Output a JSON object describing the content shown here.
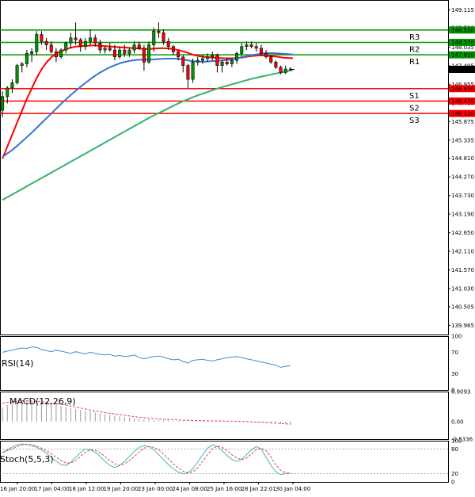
{
  "colors": {
    "resistance": "#009900",
    "support": "#ff0000",
    "bull_candle": "#009900",
    "bear_candle": "#ff0000",
    "ma_fast": "#ff0000",
    "ma_mid": "#3b6fd6",
    "ma_slow": "#33b36b",
    "rsi": "#3b8fd6",
    "macd_hist": "#999999",
    "macd_signal": "#e04040",
    "stoch_k": "#3fb6c8",
    "stoch_d": "#e04040",
    "last_price_bg": "#000000",
    "resistance_tag_bg": "#009900",
    "support_tag_bg": "#ff0000"
  },
  "chart_data": [
    {
      "type": "candlestick",
      "title": "",
      "ylim": [
        139.7,
        149.4
      ],
      "y_ticks": [
        "149.115",
        "148.590",
        "148.035",
        "147.495",
        "146.955",
        "146.415",
        "145.875",
        "145.335",
        "144.810",
        "144.270",
        "143.730",
        "143.190",
        "142.650",
        "142.110",
        "141.570",
        "141.030",
        "140.505",
        "139.965"
      ],
      "x_ticks": [
        "16 Jan 20:00",
        "17 Jan 04:00",
        "18 Jan 12:00",
        "19 Jan 20:00",
        "23 Jan 00:00",
        "24 Jan 08:00",
        "25 Jan 16:00",
        "28 Jan 22:01",
        "30 Jan 04:00"
      ],
      "last_price": {
        "label": "147.389",
        "value": 147.389
      },
      "levels": [
        {
          "name": "R3",
          "tag": "148.530",
          "value": 148.53,
          "kind": "resistance"
        },
        {
          "name": "R2",
          "tag": "148.170",
          "value": 148.17,
          "kind": "resistance"
        },
        {
          "name": "R1",
          "tag": "147.810",
          "value": 147.81,
          "kind": "resistance"
        },
        {
          "name": "S1",
          "tag": "146.830",
          "value": 146.83,
          "kind": "support"
        },
        {
          "name": "S2",
          "tag": "146.470",
          "value": 146.47,
          "kind": "support"
        },
        {
          "name": "S3",
          "tag": "146.110",
          "value": 146.11,
          "kind": "support"
        }
      ],
      "ohlc": [
        [
          146.2,
          146.75,
          146.0,
          146.6
        ],
        [
          146.6,
          146.9,
          146.4,
          146.85
        ],
        [
          146.85,
          147.1,
          146.7,
          147.0
        ],
        [
          147.0,
          147.55,
          146.95,
          147.5
        ],
        [
          147.5,
          147.6,
          147.3,
          147.55
        ],
        [
          147.55,
          147.95,
          147.45,
          147.85
        ],
        [
          147.85,
          148.0,
          147.6,
          147.9
        ],
        [
          147.9,
          148.5,
          147.8,
          148.4
        ],
        [
          148.4,
          148.5,
          148.1,
          148.2
        ],
        [
          148.2,
          148.3,
          147.95,
          148.1
        ],
        [
          148.1,
          148.2,
          147.85,
          147.9
        ],
        [
          147.9,
          148.0,
          147.6,
          147.75
        ],
        [
          147.75,
          148.0,
          147.7,
          147.95
        ],
        [
          147.95,
          148.2,
          147.85,
          148.15
        ],
        [
          148.15,
          148.45,
          148.0,
          148.3
        ],
        [
          148.3,
          148.75,
          148.1,
          148.25
        ],
        [
          148.25,
          148.3,
          147.9,
          148.05
        ],
        [
          148.05,
          148.3,
          147.95,
          148.2
        ],
        [
          148.2,
          148.55,
          148.1,
          148.3
        ],
        [
          148.3,
          148.4,
          148.05,
          148.15
        ],
        [
          148.15,
          148.25,
          147.85,
          147.95
        ],
        [
          147.95,
          148.05,
          147.85,
          148.0
        ],
        [
          148.0,
          148.15,
          147.9,
          147.95
        ],
        [
          147.95,
          148.1,
          147.65,
          147.75
        ],
        [
          147.75,
          148.05,
          147.7,
          147.95
        ],
        [
          147.95,
          148.1,
          147.75,
          147.85
        ],
        [
          147.85,
          148.0,
          147.75,
          147.95
        ],
        [
          147.95,
          148.2,
          147.85,
          148.1
        ],
        [
          148.1,
          148.2,
          147.95,
          148.0
        ],
        [
          148.0,
          148.1,
          147.35,
          147.6
        ],
        [
          147.6,
          148.2,
          147.55,
          148.1
        ],
        [
          148.1,
          148.6,
          147.9,
          148.5
        ],
        [
          148.5,
          148.75,
          148.3,
          148.45
        ],
        [
          148.45,
          148.55,
          148.1,
          148.2
        ],
        [
          148.2,
          148.3,
          147.95,
          148.05
        ],
        [
          148.05,
          148.1,
          147.8,
          147.9
        ],
        [
          147.9,
          147.95,
          147.65,
          147.75
        ],
        [
          147.75,
          147.8,
          147.3,
          147.5
        ],
        [
          147.5,
          147.55,
          146.85,
          147.1
        ],
        [
          147.1,
          147.7,
          147.0,
          147.6
        ],
        [
          147.6,
          147.75,
          147.5,
          147.65
        ],
        [
          147.65,
          147.8,
          147.55,
          147.7
        ],
        [
          147.7,
          147.85,
          147.6,
          147.75
        ],
        [
          147.75,
          147.9,
          147.65,
          147.8
        ],
        [
          147.8,
          147.85,
          147.3,
          147.5
        ],
        [
          147.5,
          147.65,
          147.3,
          147.6
        ],
        [
          147.6,
          147.7,
          147.5,
          147.55
        ],
        [
          147.55,
          147.7,
          147.45,
          147.65
        ],
        [
          147.65,
          147.9,
          147.55,
          147.85
        ],
        [
          147.85,
          148.15,
          147.75,
          148.05
        ],
        [
          148.05,
          148.2,
          147.95,
          148.1
        ],
        [
          148.1,
          148.2,
          148.0,
          148.05
        ],
        [
          148.05,
          148.15,
          147.9,
          148.0
        ],
        [
          148.0,
          148.1,
          147.8,
          147.85
        ],
        [
          147.85,
          147.95,
          147.7,
          147.75
        ],
        [
          147.75,
          147.8,
          147.55,
          147.6
        ],
        [
          147.6,
          147.65,
          147.4,
          147.45
        ],
        [
          147.45,
          147.5,
          147.25,
          147.3
        ],
        [
          147.3,
          147.5,
          147.25,
          147.4
        ],
        [
          147.4,
          147.45,
          147.35,
          147.39
        ]
      ],
      "moving_averages": [
        {
          "color_key": "ma_fast",
          "values": [
            144.8,
            145.15,
            145.5,
            145.85,
            146.2,
            146.55,
            146.85,
            147.15,
            147.4,
            147.6,
            147.75,
            147.85,
            147.92,
            147.98,
            148.02,
            148.05,
            148.06,
            148.07,
            148.08,
            148.08,
            148.07,
            148.06,
            148.05,
            148.04,
            148.03,
            148.02,
            148.01,
            148.0,
            147.99,
            147.98,
            147.98,
            147.99,
            148.0,
            148.0,
            147.99,
            147.97,
            147.94,
            147.9,
            147.85,
            147.8,
            147.77,
            147.75,
            147.74,
            147.73,
            147.72,
            147.71,
            147.71,
            147.71,
            147.72,
            147.74,
            147.76,
            147.78,
            147.79,
            147.79,
            147.78,
            147.77,
            147.75,
            147.73,
            147.72,
            147.71
          ]
        },
        {
          "color_key": "ma_mid",
          "values": [
            144.85,
            144.95,
            145.05,
            145.17,
            145.3,
            145.43,
            145.56,
            145.7,
            145.84,
            145.98,
            146.12,
            146.26,
            146.4,
            146.53,
            146.66,
            146.78,
            146.9,
            147.01,
            147.12,
            147.22,
            147.31,
            147.39,
            147.46,
            147.52,
            147.57,
            147.61,
            147.64,
            147.66,
            147.67,
            147.67,
            147.67,
            147.68,
            147.69,
            147.7,
            147.7,
            147.7,
            147.69,
            147.67,
            147.64,
            147.62,
            147.61,
            147.61,
            147.62,
            147.63,
            147.64,
            147.65,
            147.67,
            147.69,
            147.72,
            147.75,
            147.78,
            147.81,
            147.83,
            147.85,
            147.86,
            147.86,
            147.85,
            147.84,
            147.83,
            147.82
          ]
        },
        {
          "color_key": "ma_slow",
          "values": [
            143.6,
            143.68,
            143.76,
            143.84,
            143.92,
            144.0,
            144.08,
            144.16,
            144.24,
            144.32,
            144.4,
            144.48,
            144.56,
            144.64,
            144.72,
            144.8,
            144.88,
            144.96,
            145.04,
            145.12,
            145.2,
            145.28,
            145.36,
            145.44,
            145.52,
            145.6,
            145.68,
            145.76,
            145.84,
            145.92,
            146.0,
            146.07,
            146.14,
            146.21,
            146.28,
            146.35,
            146.42,
            146.48,
            146.54,
            146.6,
            146.65,
            146.7,
            146.75,
            146.8,
            146.85,
            146.89,
            146.93,
            146.97,
            147.01,
            147.05,
            147.09,
            147.13,
            147.16,
            147.19,
            147.22,
            147.25,
            147.28,
            147.31,
            147.34,
            147.37
          ]
        }
      ]
    },
    {
      "type": "line",
      "name": "RSI(14)",
      "label": "RSI(14)",
      "ylim": [
        0,
        100
      ],
      "y_ticks": [
        "100",
        "70",
        "30",
        "0"
      ],
      "series": [
        {
          "color_key": "rsi",
          "values": [
            70,
            72,
            74,
            76,
            78,
            77,
            80,
            79,
            75,
            73,
            71,
            74,
            72,
            70,
            68,
            71,
            69,
            67,
            70,
            68,
            66,
            65,
            66,
            63,
            64,
            62,
            63,
            65,
            60,
            58,
            60,
            62,
            63,
            61,
            58,
            56,
            57,
            53,
            50,
            55,
            56,
            57,
            55,
            54,
            56,
            58,
            60,
            61,
            62,
            60,
            58,
            56,
            54,
            52,
            50,
            48,
            46,
            42,
            44,
            45
          ]
        }
      ]
    },
    {
      "type": "bar",
      "name": "MACD(12,26,9)",
      "label": "MACD(12,26,9)",
      "ylim": [
        -0.5336,
        0.9093
      ],
      "y_ticks": [
        "0.9093",
        "0.00",
        "-0.5336"
      ],
      "series": [
        {
          "name": "histogram",
          "color_key": "macd_hist",
          "values": [
            0.42,
            0.5,
            0.55,
            0.6,
            0.62,
            0.63,
            0.62,
            0.6,
            0.58,
            0.55,
            0.52,
            0.5,
            0.47,
            0.44,
            0.41,
            0.38,
            0.35,
            0.32,
            0.3,
            0.28,
            0.25,
            0.22,
            0.2,
            0.18,
            0.16,
            0.14,
            0.12,
            0.1,
            0.08,
            0.07,
            0.06,
            0.05,
            0.05,
            0.04,
            0.04,
            0.03,
            0.03,
            0.02,
            0.01,
            0.01,
            0.02,
            0.02,
            0.02,
            0.01,
            0.01,
            0.01,
            0.01,
            0.0,
            0.0,
            0.0,
            -0.01,
            -0.01,
            -0.02,
            -0.03,
            -0.04,
            -0.05,
            -0.06,
            -0.07,
            -0.08,
            -0.09
          ]
        },
        {
          "name": "signal",
          "color_key": "macd_signal",
          "values": [
            0.55,
            0.58,
            0.6,
            0.62,
            0.63,
            0.63,
            0.62,
            0.61,
            0.6,
            0.58,
            0.56,
            0.54,
            0.52,
            0.5,
            0.47,
            0.44,
            0.41,
            0.38,
            0.35,
            0.32,
            0.3,
            0.27,
            0.25,
            0.23,
            0.21,
            0.19,
            0.17,
            0.15,
            0.13,
            0.12,
            0.1,
            0.09,
            0.08,
            0.07,
            0.06,
            0.06,
            0.05,
            0.04,
            0.04,
            0.03,
            0.03,
            0.03,
            0.02,
            0.02,
            0.02,
            0.02,
            0.01,
            0.01,
            0.01,
            0.0,
            0.0,
            -0.01,
            -0.02,
            -0.02,
            -0.03,
            -0.04,
            -0.05,
            -0.06,
            -0.07,
            -0.08
          ]
        }
      ]
    },
    {
      "type": "line",
      "name": "Stoch(5,5,3)",
      "label": "Stoch(5,5,3)",
      "ylim": [
        0,
        100
      ],
      "y_ticks": [
        "100",
        "80",
        "20",
        "0"
      ],
      "series": [
        {
          "name": "%K",
          "color_key": "stoch_k",
          "values": [
            70,
            78,
            85,
            90,
            92,
            91,
            88,
            84,
            78,
            70,
            60,
            50,
            42,
            40,
            48,
            60,
            72,
            80,
            78,
            72,
            62,
            50,
            40,
            35,
            40,
            50,
            62,
            74,
            84,
            88,
            86,
            78,
            66,
            54,
            42,
            32,
            24,
            20,
            22,
            32,
            48,
            66,
            82,
            90,
            86,
            76,
            64,
            55,
            50,
            55,
            66,
            78,
            86,
            80,
            60,
            40,
            25,
            18,
            20,
            22
          ]
        },
        {
          "name": "%D",
          "color_key": "stoch_d",
          "values": [
            72,
            76,
            80,
            86,
            90,
            91,
            90,
            87,
            82,
            76,
            68,
            60,
            52,
            46,
            46,
            52,
            62,
            72,
            78,
            77,
            71,
            62,
            52,
            44,
            40,
            44,
            52,
            62,
            73,
            82,
            86,
            84,
            78,
            68,
            56,
            44,
            34,
            26,
            22,
            24,
            34,
            50,
            66,
            80,
            87,
            84,
            76,
            66,
            58,
            54,
            58,
            68,
            78,
            82,
            76,
            60,
            42,
            28,
            22,
            20
          ]
        }
      ]
    }
  ]
}
